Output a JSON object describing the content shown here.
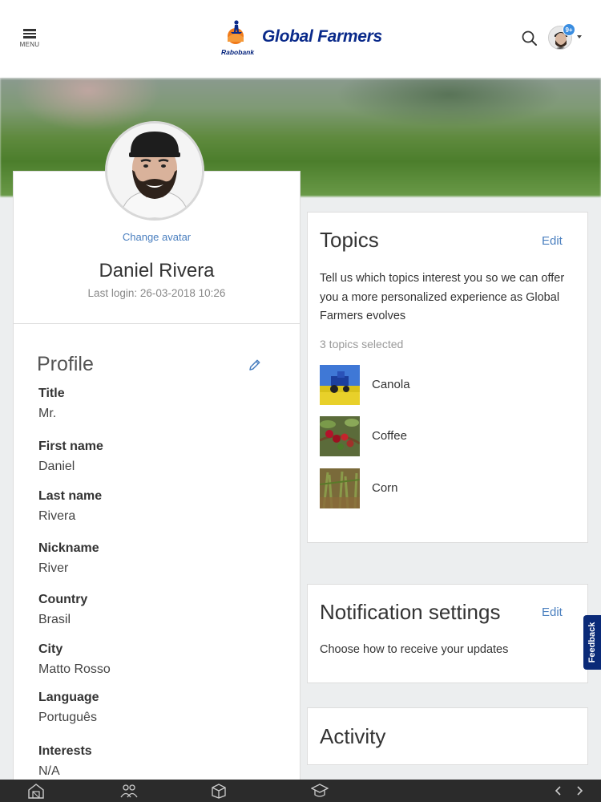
{
  "header": {
    "menu_label": "MENU",
    "logo_text": "Rabobank",
    "brand_title": "Global Farmers",
    "notification_count": "9+"
  },
  "profile_card": {
    "change_avatar": "Change avatar",
    "name": "Daniel Rivera",
    "last_login": "Last login: 26-03-2018 10:26",
    "heading": "Profile",
    "fields": [
      {
        "label": "Title",
        "value": "Mr."
      },
      {
        "label": "First name",
        "value": "Daniel"
      },
      {
        "label": "Last name",
        "value": "Rivera"
      },
      {
        "label": "Nickname",
        "value": "River"
      },
      {
        "label": "Country",
        "value": "Brasil"
      },
      {
        "label": "City",
        "value": "Matto Rosso"
      },
      {
        "label": "Language",
        "value": "Português"
      },
      {
        "label": "Interests",
        "value": "N/A"
      }
    ]
  },
  "topics": {
    "title": "Topics",
    "edit": "Edit",
    "description": "Tell us which topics interest you so we can offer you a more personalized experience as Global Farmers evolves",
    "count": "3 topics selected",
    "items": [
      {
        "label": "Canola",
        "thumb": "canola-field"
      },
      {
        "label": "Coffee",
        "thumb": "coffee-cherries"
      },
      {
        "label": "Corn",
        "thumb": "corn-field"
      }
    ]
  },
  "notifications": {
    "title": "Notification settings",
    "edit": "Edit",
    "description": "Choose how to receive your updates"
  },
  "activity": {
    "title": "Activity"
  },
  "feedback": {
    "label": "Feedback"
  },
  "bottom_bar": {
    "icons": [
      "barn-icon",
      "people-icon",
      "box-icon",
      "graduation-cap-icon",
      "chevron-left-icon",
      "chevron-right-icon"
    ]
  },
  "colors": {
    "accent": "#4a7fbf",
    "brand": "#0a2a8a",
    "feedback": "#0a2a78",
    "badge": "#3a8de0"
  }
}
